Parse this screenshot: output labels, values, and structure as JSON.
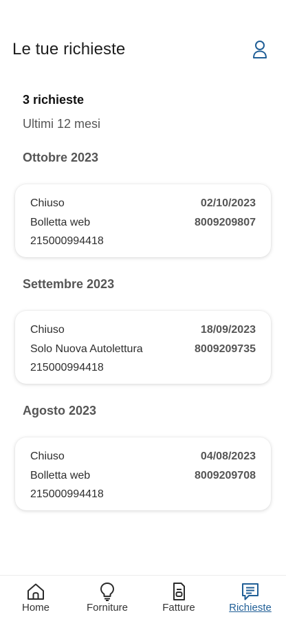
{
  "header": {
    "title": "Le tue richieste",
    "profile_icon": "user-icon"
  },
  "summary": {
    "count": "3 richieste",
    "period": "Ultimi 12 mesi"
  },
  "groups": [
    {
      "month": "Ottobre 2023",
      "card": {
        "status": "Chiuso",
        "date": "02/10/2023",
        "type": "Bolletta web",
        "code": "8009209807",
        "supply": "215000994418"
      }
    },
    {
      "month": "Settembre 2023",
      "card": {
        "status": "Chiuso",
        "date": "18/09/2023",
        "type": "Solo Nuova Autolettura",
        "code": "8009209735",
        "supply": "215000994418"
      }
    },
    {
      "month": "Agosto 2023",
      "card": {
        "status": "Chiuso",
        "date": "04/08/2023",
        "type": "Bolletta web",
        "code": "8009209708",
        "supply": "215000994418"
      }
    }
  ],
  "tabbar": {
    "tabs": [
      {
        "label": "Home",
        "icon": "home-icon"
      },
      {
        "label": "Forniture",
        "icon": "lightbulb-icon"
      },
      {
        "label": "Fatture",
        "icon": "document-icon"
      },
      {
        "label": "Richieste",
        "icon": "chat-icon",
        "active": true
      }
    ]
  },
  "colors": {
    "accent": "#1f5e96",
    "text": "#1e1e1e",
    "muted": "#555555"
  }
}
